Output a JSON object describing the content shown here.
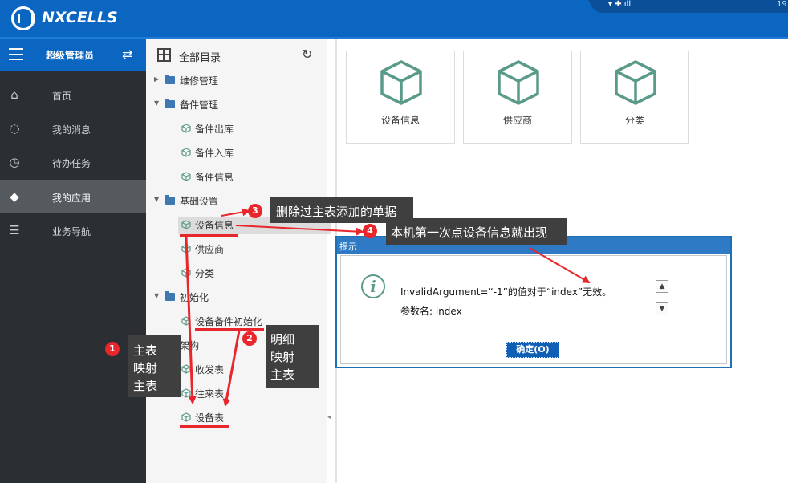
{
  "header": {
    "brand": "NXCELLS",
    "top_right_text": "19"
  },
  "sidebar": {
    "user": "超级管理员",
    "items": [
      {
        "label": "首页",
        "icon": "home-icon"
      },
      {
        "label": "我的消息",
        "icon": "message-icon"
      },
      {
        "label": "待办任务",
        "icon": "timer-icon"
      },
      {
        "label": "我的应用",
        "icon": "cube-icon"
      },
      {
        "label": "业务导航",
        "icon": "navigation-icon"
      }
    ],
    "active_index": 3
  },
  "tree": {
    "title": "全部目录",
    "nodes": [
      {
        "label": "维修管理",
        "type": "folder",
        "expanded": false
      },
      {
        "label": "备件管理",
        "type": "folder",
        "expanded": true
      },
      {
        "label": "备件出库",
        "type": "leaf"
      },
      {
        "label": "备件入库",
        "type": "leaf"
      },
      {
        "label": "备件信息",
        "type": "leaf"
      },
      {
        "label": "基础设置",
        "type": "folder",
        "expanded": true
      },
      {
        "label": "设备信息",
        "type": "leaf",
        "selected": true
      },
      {
        "label": "供应商",
        "type": "leaf"
      },
      {
        "label": "分类",
        "type": "leaf"
      },
      {
        "label": "初始化",
        "type": "folder",
        "expanded": true
      },
      {
        "label": "设备备件初始化",
        "type": "leaf"
      },
      {
        "label": "架构",
        "type": "folder",
        "expanded": false
      },
      {
        "label": "收发表",
        "type": "leaf"
      },
      {
        "label": "往来表",
        "type": "leaf"
      },
      {
        "label": "设备表",
        "type": "leaf"
      }
    ]
  },
  "tiles": [
    {
      "label": "设备信息"
    },
    {
      "label": "供应商"
    },
    {
      "label": "分类"
    }
  ],
  "dialog": {
    "title": "提示",
    "message_line1": "InvalidArgument=“-1”的值对于“index”无效。",
    "message_line2": "参数名: index",
    "ok_label": "确定(O)"
  },
  "annotations": [
    {
      "number": "1",
      "text_lines": [
        "主表",
        "映射",
        "主表"
      ]
    },
    {
      "number": "2",
      "text_lines": [
        "明细",
        "映射",
        "主表"
      ]
    },
    {
      "number": "3",
      "text": "删除过主表添加的单据"
    },
    {
      "number": "4",
      "text": "本机第一次点设备信息就出现"
    }
  ],
  "colors": {
    "header_blue": "#0b66c2",
    "sidebar_dark": "#2b2f33",
    "annotation_red": "#e8262c",
    "cube_green": "#5a9a8a"
  }
}
